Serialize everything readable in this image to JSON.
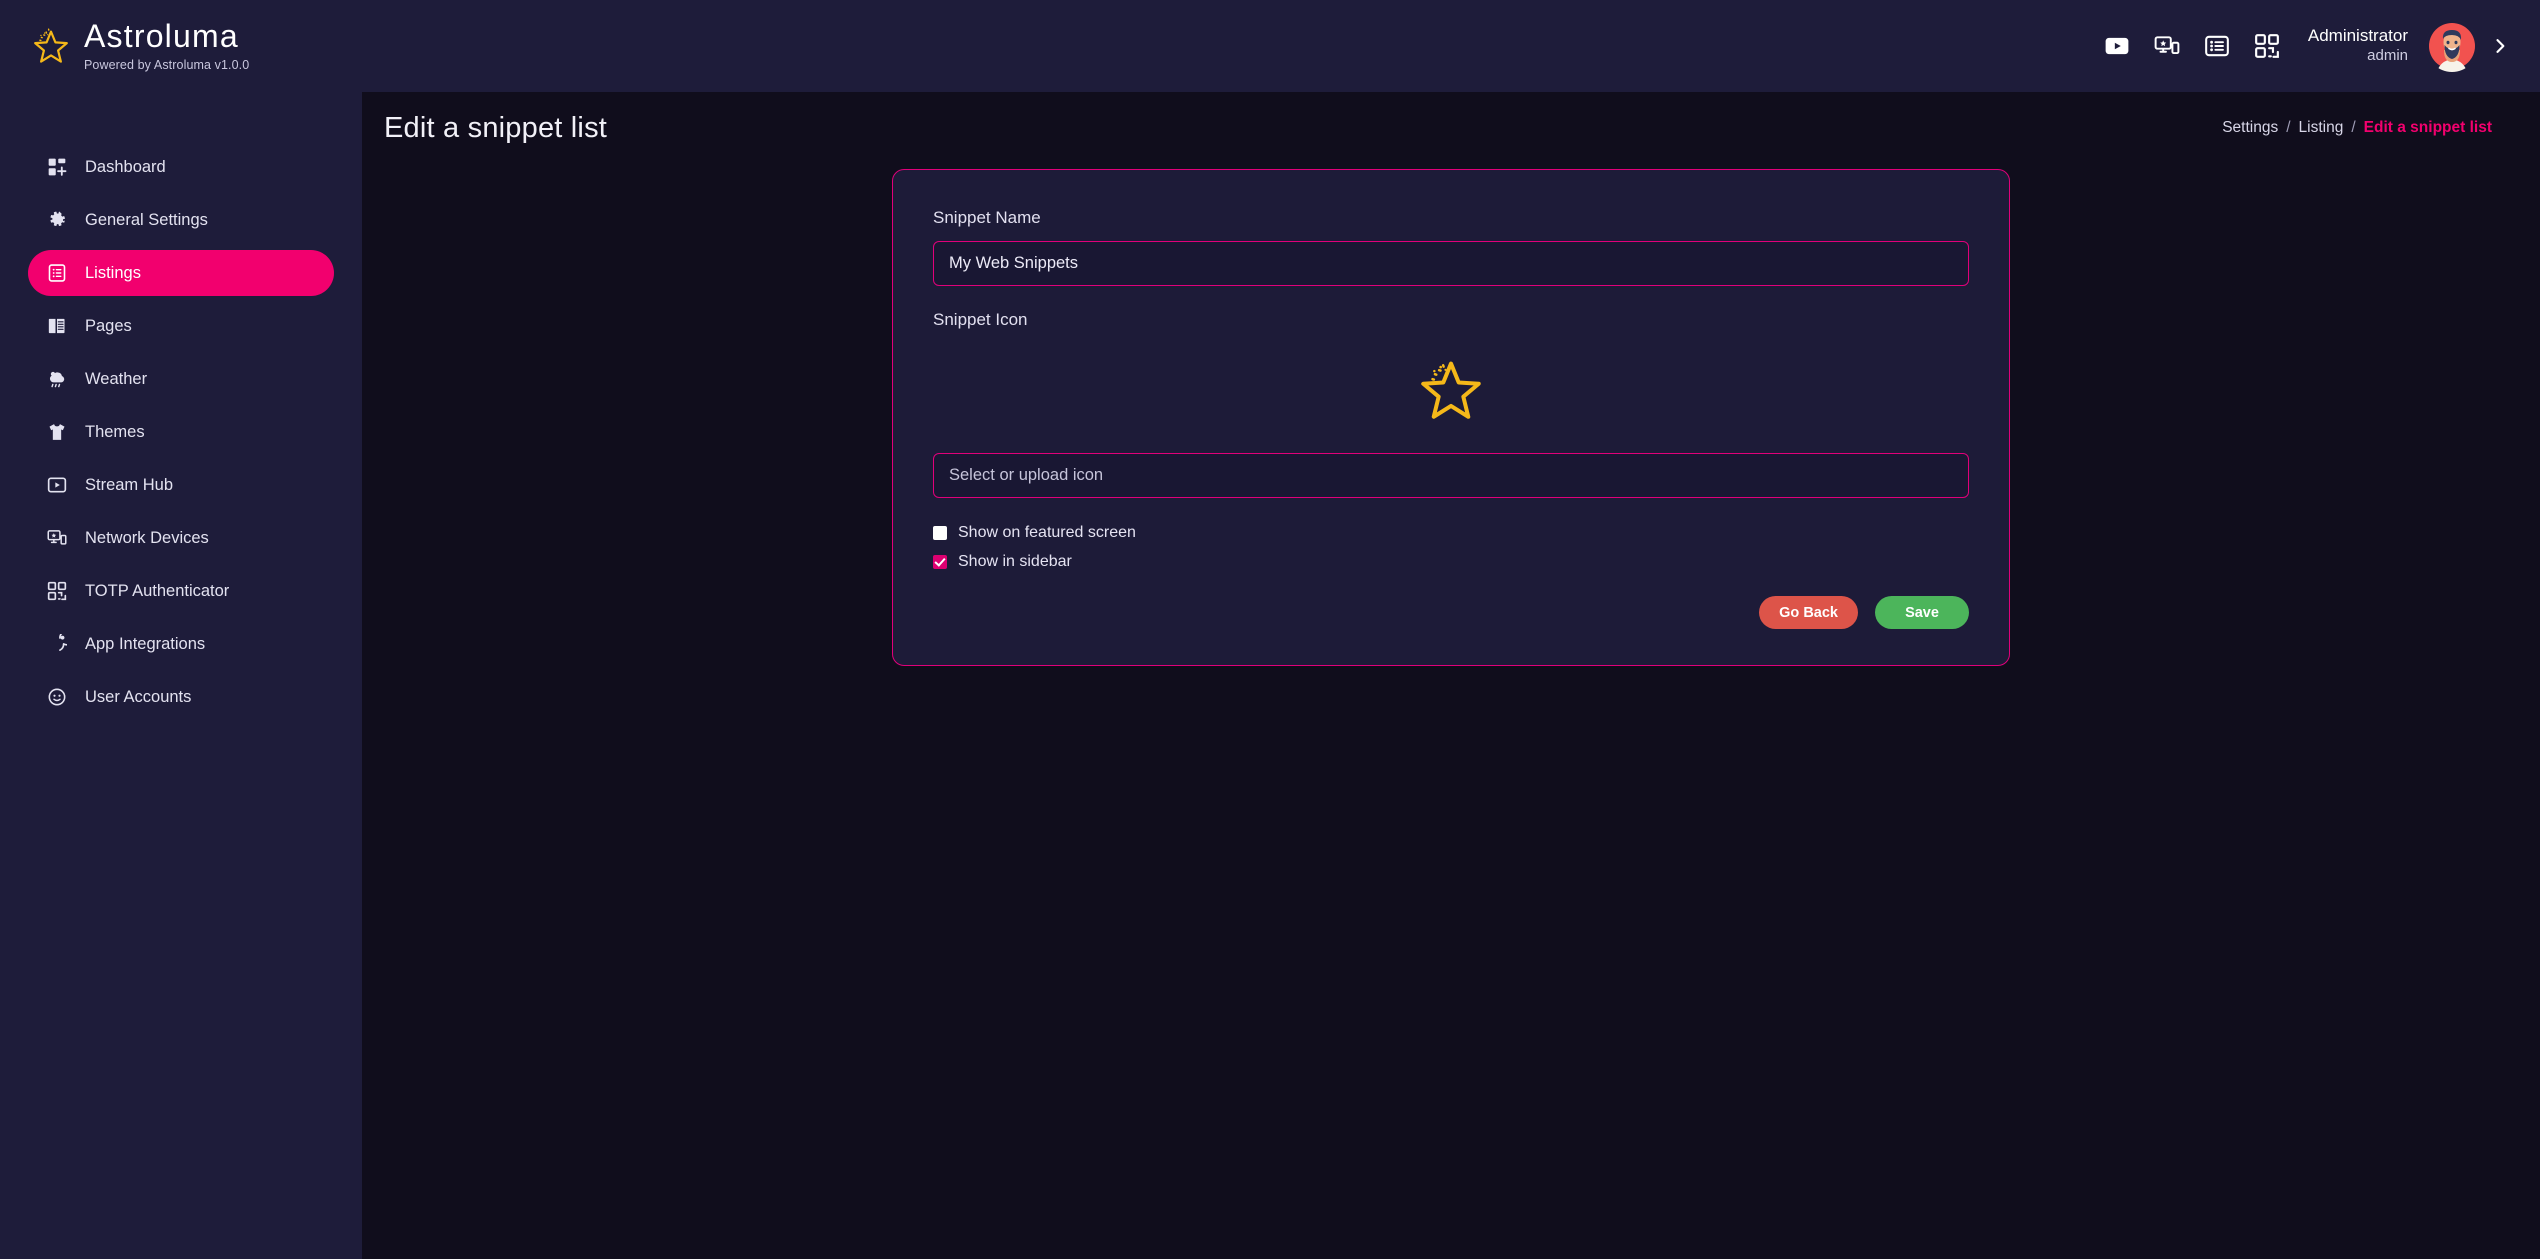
{
  "brand": {
    "name": "Astroluma",
    "subtitle": "Powered by Astroluma v1.0.0",
    "logo_icon": "star-sparkle-icon"
  },
  "colors": {
    "accent_pink": "#f2006e",
    "card_border": "#e0007a",
    "sidebar_bg": "#1e1c3a",
    "main_bg": "#100d1c",
    "card_bg": "#1d1b38",
    "star_gold": "#f5b819",
    "btn_back": "#dd5449",
    "btn_save": "#4cb55b"
  },
  "sidebar": {
    "items": [
      {
        "label": "Dashboard",
        "icon": "dashboard-grid-icon",
        "active": false
      },
      {
        "label": "General Settings",
        "icon": "gear-icon",
        "active": false
      },
      {
        "label": "Listings",
        "icon": "list-box-icon",
        "active": true
      },
      {
        "label": "Pages",
        "icon": "book-icon",
        "active": false
      },
      {
        "label": "Weather",
        "icon": "cloud-rain-icon",
        "active": false
      },
      {
        "label": "Themes",
        "icon": "tshirt-icon",
        "active": false
      },
      {
        "label": "Stream Hub",
        "icon": "play-box-icon",
        "active": false
      },
      {
        "label": "Network Devices",
        "icon": "monitor-device-icon",
        "active": false
      },
      {
        "label": "TOTP Authenticator",
        "icon": "qr-code-icon",
        "active": false
      },
      {
        "label": "App Integrations",
        "icon": "power-circle-icon",
        "active": false
      },
      {
        "label": "User Accounts",
        "icon": "user-circle-icon",
        "active": false
      }
    ]
  },
  "topbar": {
    "icons": [
      {
        "name": "play-video-icon"
      },
      {
        "name": "device-star-icon"
      },
      {
        "name": "list-view-icon"
      },
      {
        "name": "qr-code-icon"
      }
    ],
    "user_name": "Administrator",
    "user_role": "admin",
    "avatar_icon": "user-avatar",
    "expand_icon": "chevron-right-icon"
  },
  "page": {
    "title": "Edit a snippet list",
    "breadcrumb": [
      {
        "label": "Settings",
        "current": false
      },
      {
        "label": "Listing",
        "current": false
      },
      {
        "label": "Edit a snippet list",
        "current": true
      }
    ],
    "separator": "/"
  },
  "form": {
    "snippet_name_label": "Snippet Name",
    "snippet_name_value": "My Web Snippets",
    "snippet_name_placeholder": "Snippet Name",
    "snippet_icon_label": "Snippet Icon",
    "snippet_icon_preview": "star-sparkle-icon",
    "icon_input_value": "",
    "icon_input_placeholder": "Select or upload icon",
    "checkboxes": [
      {
        "label": "Show on featured screen",
        "checked": false
      },
      {
        "label": "Show in sidebar",
        "checked": true
      }
    ],
    "go_back_label": "Go Back",
    "save_label": "Save"
  }
}
